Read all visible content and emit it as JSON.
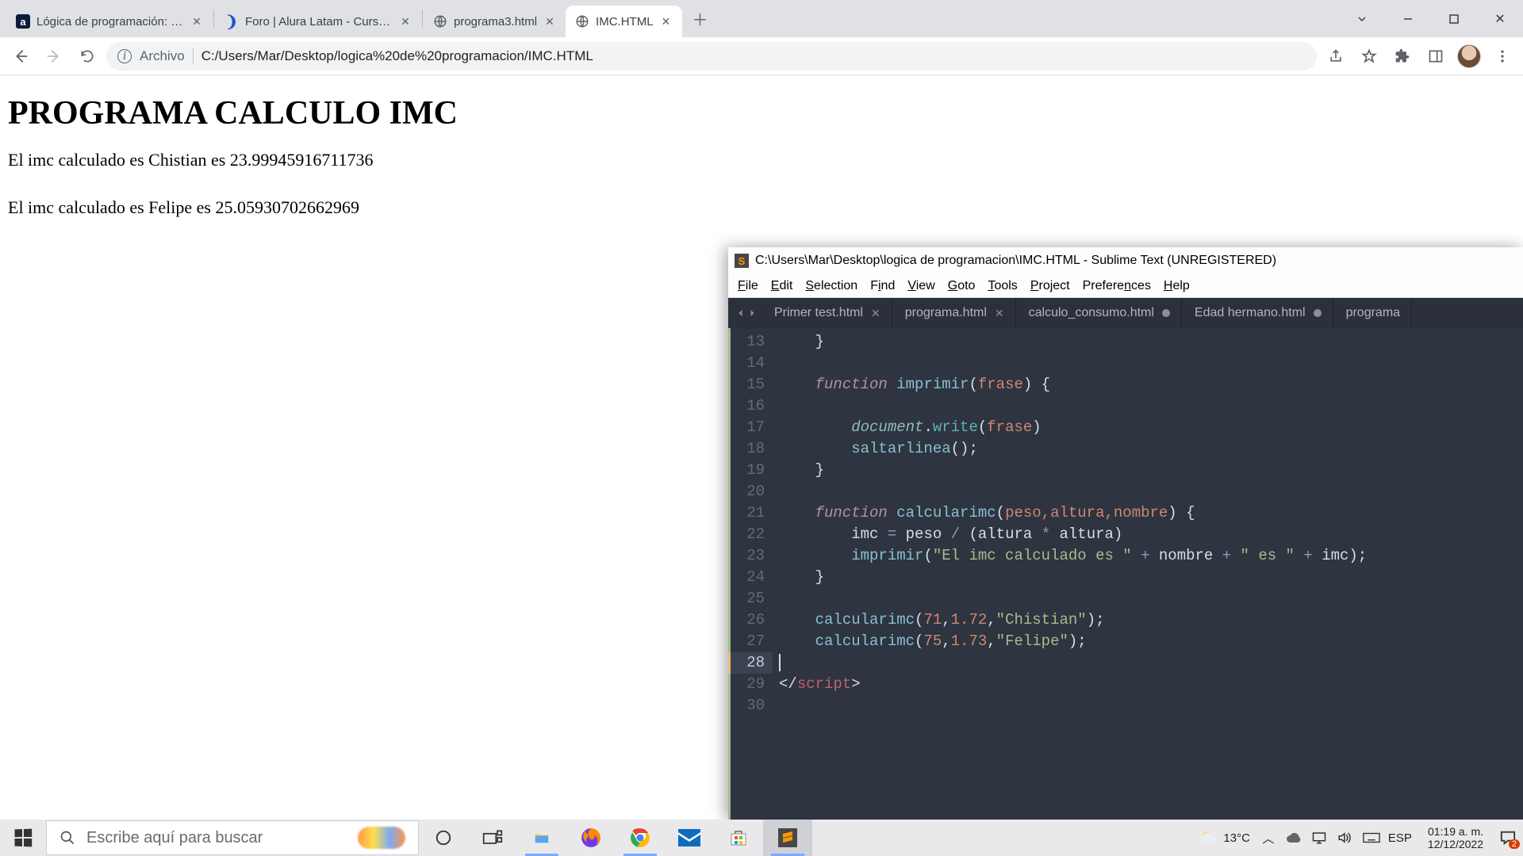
{
  "chrome": {
    "tabs": [
      {
        "label": "Lógica de programación: Primero",
        "favicon": "a"
      },
      {
        "label": "Foro | Alura Latam - Cursos online",
        "favicon": ")"
      },
      {
        "label": "programa3.html",
        "favicon": "globe"
      },
      {
        "label": "IMC.HTML",
        "favicon": "globe",
        "active": true
      }
    ],
    "omnibox_prefix": "Archivo",
    "omnibox_path": "C:/Users/Mar/Desktop/logica%20de%20programacion/IMC.HTML"
  },
  "page": {
    "h1": "PROGRAMA CALCULO IMC",
    "line1": "El imc calculado es Chistian es 23.99945916711736",
    "line2": "El imc calculado es Felipe es 25.05930702662969"
  },
  "sublime": {
    "title": "C:\\Users\\Mar\\Desktop\\logica de programacion\\IMC.HTML - Sublime Text (UNREGISTERED)",
    "menu": [
      "File",
      "Edit",
      "Selection",
      "Find",
      "View",
      "Goto",
      "Tools",
      "Project",
      "Preferences",
      "Help"
    ],
    "tabs": [
      {
        "label": "Primer test.html",
        "close": "x"
      },
      {
        "label": "programa.html",
        "close": "x"
      },
      {
        "label": "calculo_consumo.html",
        "close": "dot"
      },
      {
        "label": "Edad hermano.html",
        "close": "dot"
      },
      {
        "label": "programa",
        "close": ""
      }
    ],
    "first_line_no": 13,
    "cursor_line": 28,
    "code": {
      "l13": "    }",
      "l14": "",
      "l15a": "    ",
      "l15_kw": "function",
      "l15b": " ",
      "l15_fn": "imprimir",
      "l15c": "(",
      "l15_p": "frase",
      "l15d": ") {",
      "l16": "",
      "l17a": "        ",
      "l17_doc": "document",
      "l17_dot": ".",
      "l17_w": "write",
      "l17b": "(",
      "l17_arg": "frase",
      "l17c": ")",
      "l18a": "        ",
      "l18_fn": "saltarlinea",
      "l18b": "();",
      "l19": "    }",
      "l20": "",
      "l21a": "    ",
      "l21_kw": "function",
      "l21b": " ",
      "l21_fn": "calcularimc",
      "l21c": "(",
      "l21_p": "peso,altura,nombre",
      "l21d": ") {",
      "l22a": "        imc ",
      "l22_eq": "=",
      "l22b": " peso ",
      "l22_div": "/",
      "l22c": " (altura ",
      "l22_mul": "*",
      "l22d": " altura)",
      "l23a": "        ",
      "l23_fn": "imprimir",
      "l23b": "(",
      "l23_s1": "\"El imc calculado es \"",
      "l23_p1": " + ",
      "l23_n": "nombre",
      "l23_p2": " + ",
      "l23_s2": "\" es \"",
      "l23_p3": " + ",
      "l23_i": "imc",
      "l23c": ");",
      "l24": "    }",
      "l25": "",
      "l26a": "    ",
      "l26_fn": "calcularimc",
      "l26b": "(",
      "l26_n1": "71",
      "l26c": ",",
      "l26_n2": "1.72",
      "l26d": ",",
      "l26_s": "\"Chistian\"",
      "l26e": ");",
      "l27a": "    ",
      "l27_fn": "calcularimc",
      "l27b": "(",
      "l27_n1": "75",
      "l27c": ",",
      "l27_n2": "1.73",
      "l27d": ",",
      "l27_s": "\"Felipe\"",
      "l27e": ");",
      "l28": "",
      "l29a": "</",
      "l29_tag": "script",
      "l29b": ">",
      "l30": ""
    }
  },
  "taskbar": {
    "search_placeholder": "Escribe aquí para buscar",
    "weather": "13°C",
    "lang": "ESP",
    "time": "01:19 a. m.",
    "date": "12/12/2022",
    "notif_badge": "2"
  }
}
